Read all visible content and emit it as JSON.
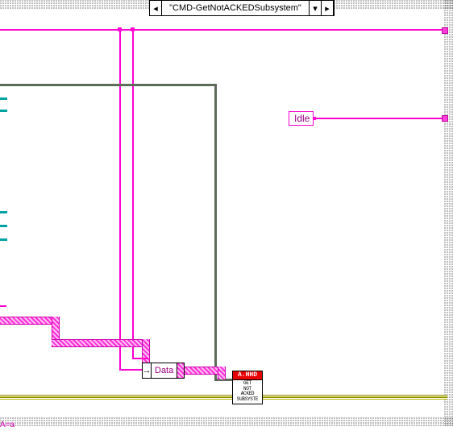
{
  "case": {
    "selected_label": "\"CMD-GetNotACKEDSubsystem\"",
    "prev_glyph": "◂",
    "next_glyph": "▸",
    "drop_glyph": "▾"
  },
  "idle_const": {
    "text": "Idle"
  },
  "unbundle": {
    "in_glyph": "→",
    "field": "Data"
  },
  "sub_node": {
    "header": "A.HHD",
    "body": "GET\nNOT\nACKED\nSUBSYSTE"
  },
  "footer_note": "A=a"
}
